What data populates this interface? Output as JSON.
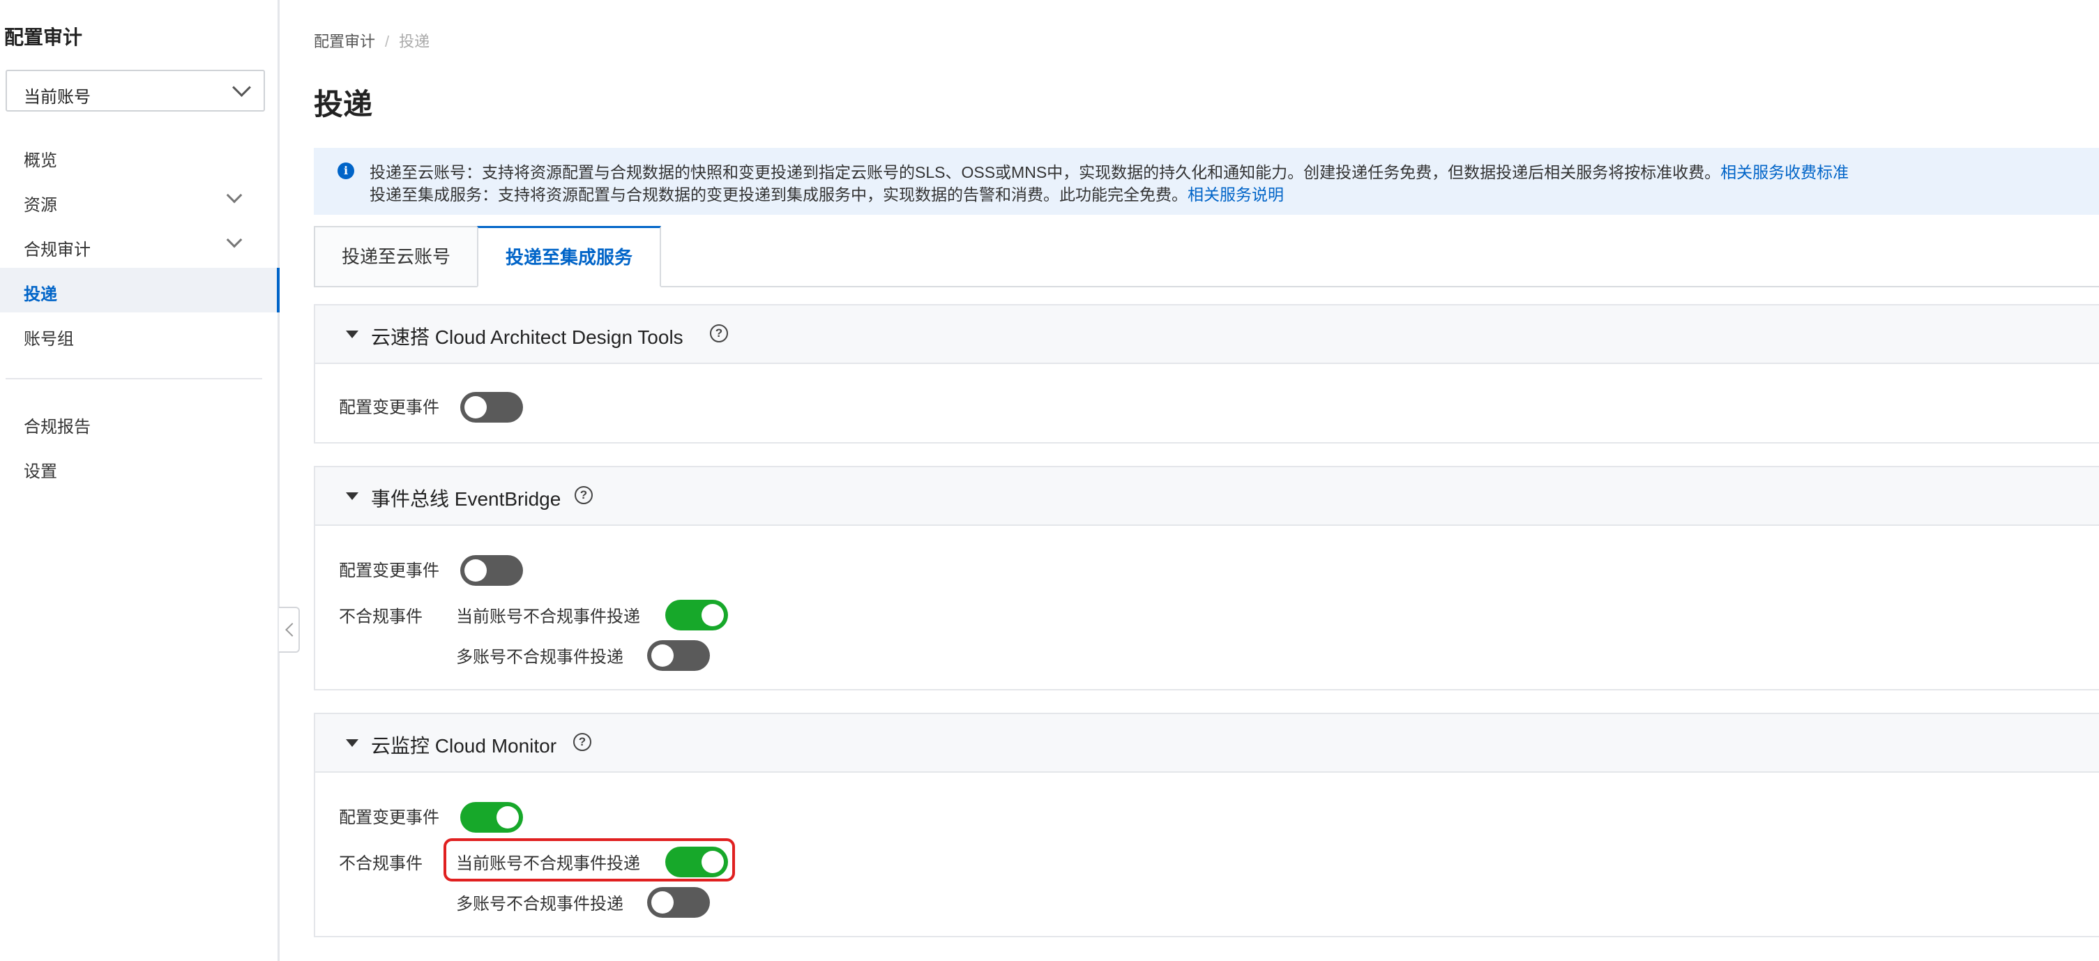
{
  "app_title": "配置审计",
  "account_select": {
    "value": "当前账号"
  },
  "nav": {
    "items": [
      {
        "label": "概览",
        "expandable": false,
        "active": false
      },
      {
        "label": "资源",
        "expandable": true,
        "active": false
      },
      {
        "label": "合规审计",
        "expandable": true,
        "active": false
      },
      {
        "label": "投递",
        "expandable": false,
        "active": true
      },
      {
        "label": "账号组",
        "expandable": false,
        "active": false
      }
    ],
    "bottom_items": [
      {
        "label": "合规报告"
      },
      {
        "label": "设置"
      }
    ]
  },
  "breadcrumb": {
    "root": "配置审计",
    "separator": "/",
    "current": "投递"
  },
  "page_title": "投递",
  "notice": {
    "line1_text": "投递至云账号：支持将资源配置与合规数据的快照和变更投递到指定云账号的SLS、OSS或MNS中，实现数据的持久化和通知能力。创建投递任务免费，但数据投递后相关服务将按标准收费。",
    "line1_link": "相关服务收费标准",
    "line2_text": "投递至集成服务：支持将资源配置与合规数据的变更投递到集成服务中，实现数据的告警和消费。此功能完全免费。",
    "line2_link": "相关服务说明"
  },
  "tabs": [
    {
      "label": "投递至云账号",
      "active": false
    },
    {
      "label": "投递至集成服务",
      "active": true
    }
  ],
  "panels": [
    {
      "title": "云速搭 Cloud Architect Design Tools",
      "config_change_label": "配置变更事件",
      "config_change_on": false
    },
    {
      "title": "事件总线 EventBridge",
      "config_change_label": "配置变更事件",
      "config_change_on": false,
      "noncompliant_label": "不合规事件",
      "current_account_label": "当前账号不合规事件投递",
      "current_account_on": true,
      "multi_account_label": "多账号不合规事件投递",
      "multi_account_on": false
    },
    {
      "title": "云监控 Cloud Monitor",
      "config_change_label": "配置变更事件",
      "config_change_on": true,
      "noncompliant_label": "不合规事件",
      "current_account_label": "当前账号不合规事件投递",
      "current_account_on": true,
      "multi_account_label": "多账号不合规事件投递",
      "multi_account_on": false
    }
  ],
  "help_glyph": "?",
  "info_glyph": "i",
  "colors": {
    "accent": "#0064c8",
    "toggle_on": "#17a82a",
    "toggle_off": "#5a5a5a",
    "highlight": "#e02020"
  }
}
